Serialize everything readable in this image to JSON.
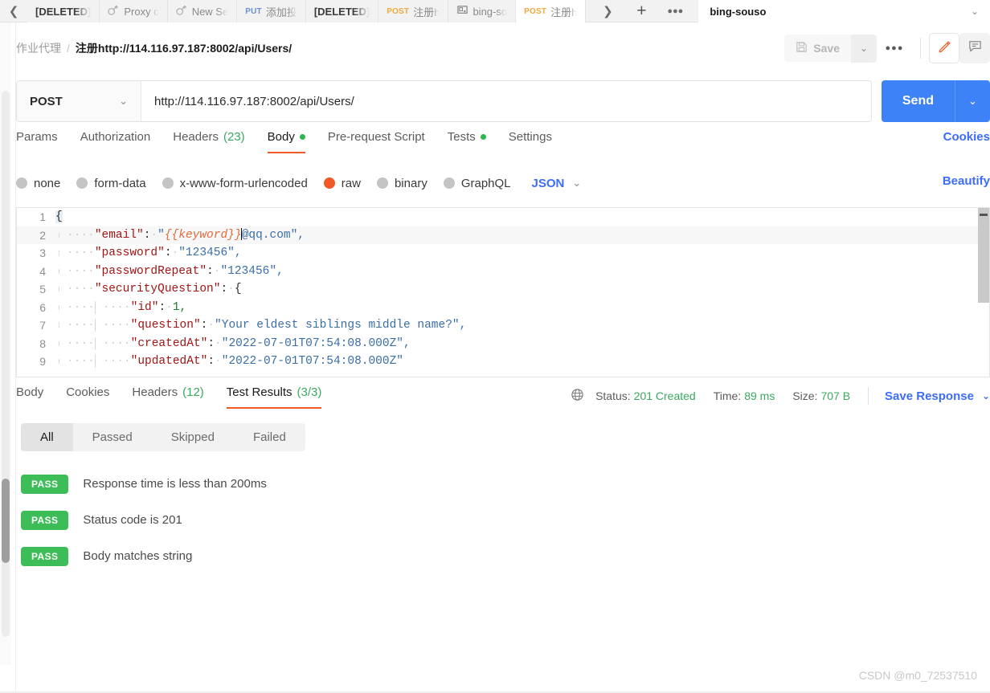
{
  "tabbar": {
    "scroll_left_icon": "chevron-left-icon",
    "tabs": [
      {
        "label": "[DELETED]",
        "method": "",
        "icon": "",
        "deleted": true,
        "active": false
      },
      {
        "label": "Proxy c",
        "method": "",
        "icon": "socket-icon",
        "deleted": false,
        "active": false
      },
      {
        "label": "New Se",
        "method": "",
        "icon": "socket-icon",
        "deleted": false,
        "active": false
      },
      {
        "label": "添加投",
        "method": "PUT",
        "icon": "",
        "deleted": false,
        "active": false
      },
      {
        "label": "[DELETED]",
        "method": "",
        "icon": "",
        "deleted": true,
        "active": false
      },
      {
        "label": "注册h",
        "method": "POST",
        "icon": "",
        "deleted": false,
        "active": false
      },
      {
        "label": "bing-so",
        "method": "",
        "icon": "monitor-icon",
        "deleted": false,
        "active": false
      },
      {
        "label": "注册h",
        "method": "POST",
        "icon": "",
        "deleted": false,
        "active": true
      }
    ],
    "scroll_right_icon": "chevron-right-icon",
    "new_tab_icon": "plus-icon",
    "more_icon": "ellipsis-icon",
    "environment": "bing-souso",
    "env_caret_icon": "chevron-down-icon"
  },
  "breadcrumb": {
    "folder": "作业代理",
    "separator": "/",
    "name": "注册http://114.116.97.187:8002/api/Users/"
  },
  "header_actions": {
    "save_label": "Save",
    "save_icon": "floppy-disk-icon",
    "save_caret_icon": "chevron-down-icon",
    "more_icon": "ellipsis-icon",
    "edit_icon": "pencil-icon",
    "comment_icon": "comment-icon"
  },
  "request": {
    "method": "POST",
    "method_caret_icon": "chevron-down-icon",
    "url": "http://114.116.97.187:8002/api/Users/",
    "send_label": "Send",
    "send_caret_icon": "chevron-down-icon"
  },
  "request_tabs": {
    "items": [
      {
        "label": "Params",
        "count": "",
        "dot": false,
        "active": false
      },
      {
        "label": "Authorization",
        "count": "",
        "dot": false,
        "active": false
      },
      {
        "label": "Headers",
        "count": "(23)",
        "dot": false,
        "active": false
      },
      {
        "label": "Body",
        "count": "",
        "dot": true,
        "active": true
      },
      {
        "label": "Pre-request Script",
        "count": "",
        "dot": false,
        "active": false
      },
      {
        "label": "Tests",
        "count": "",
        "dot": true,
        "active": false
      },
      {
        "label": "Settings",
        "count": "",
        "dot": false,
        "active": false
      }
    ],
    "cookies_label": "Cookies"
  },
  "body_types": {
    "options": [
      {
        "label": "none",
        "selected": false
      },
      {
        "label": "form-data",
        "selected": false
      },
      {
        "label": "x-www-form-urlencoded",
        "selected": false
      },
      {
        "label": "raw",
        "selected": true
      },
      {
        "label": "binary",
        "selected": false
      },
      {
        "label": "GraphQL",
        "selected": false
      }
    ],
    "format": "JSON",
    "format_caret_icon": "chevron-down-icon",
    "beautify_label": "Beautify"
  },
  "editor": {
    "lines": [
      {
        "no": "1"
      },
      {
        "no": "2"
      },
      {
        "no": "3"
      },
      {
        "no": "4"
      },
      {
        "no": "5"
      },
      {
        "no": "6"
      },
      {
        "no": "7"
      },
      {
        "no": "8"
      },
      {
        "no": "9"
      }
    ],
    "raw_text": "{\n    \"email\": \"{{keyword}}@qq.com\",\n    \"password\": \"123456\",\n    \"passwordRepeat\": \"123456\",\n    \"securityQuestion\": {\n        \"id\": 1,\n        \"question\": \"Your eldest siblings middle name?\",\n        \"createdAt\": \"2022-07-01T07:54:08.000Z\",\n        \"updatedAt\": \"2022-07-01T07:54:08.000Z\"",
    "values": {
      "email_key": "\"email\"",
      "email_var": "{{keyword}}",
      "email_domain": "@qq.com\",",
      "password_key": "\"password\"",
      "password_value": "\"123456\",",
      "password_repeat_key": "\"passwordRepeat\"",
      "password_repeat_value": "\"123456\",",
      "security_question_key": "\"securityQuestion\"",
      "id_key": "\"id\"",
      "id_value": "1,",
      "question_key": "\"question\"",
      "question_value": "\"Your eldest siblings middle name?\",",
      "created_at_key": "\"createdAt\"",
      "created_at_value": "\"2022-07-01T07:54:08.000Z\",",
      "updated_at_key": "\"updatedAt\"",
      "updated_at_value": "\"2022-07-01T07:54:08.000Z\""
    }
  },
  "response": {
    "tabs": [
      {
        "label": "Body",
        "count": "",
        "active": false
      },
      {
        "label": "Cookies",
        "count": "",
        "active": false
      },
      {
        "label": "Headers",
        "count": "(12)",
        "active": false
      },
      {
        "label": "Test Results",
        "count": "(3/3)",
        "active": true
      }
    ],
    "globe_icon": "globe-icon",
    "status_key": "Status:",
    "status_value": "201 Created",
    "time_key": "Time:",
    "time_value": "89 ms",
    "size_key": "Size:",
    "size_value": "707 B",
    "save_response_label": "Save Response",
    "save_response_caret_icon": "chevron-down-icon"
  },
  "test_filters": [
    {
      "label": "All",
      "active": true
    },
    {
      "label": "Passed",
      "active": false
    },
    {
      "label": "Skipped",
      "active": false
    },
    {
      "label": "Failed",
      "active": false
    }
  ],
  "test_results": [
    {
      "status": "PASS",
      "name": "Response time is less than 200ms"
    },
    {
      "status": "PASS",
      "name": "Status code is 201"
    },
    {
      "status": "PASS",
      "name": "Body matches string"
    }
  ],
  "watermark": "CSDN @m0_72537510",
  "colors": {
    "accent_orange": "#ef5b25",
    "send_blue": "#3d82f7",
    "link_blue": "#3d6df7",
    "pass_green": "#3dbd58",
    "status_green": "#3aa95f"
  }
}
